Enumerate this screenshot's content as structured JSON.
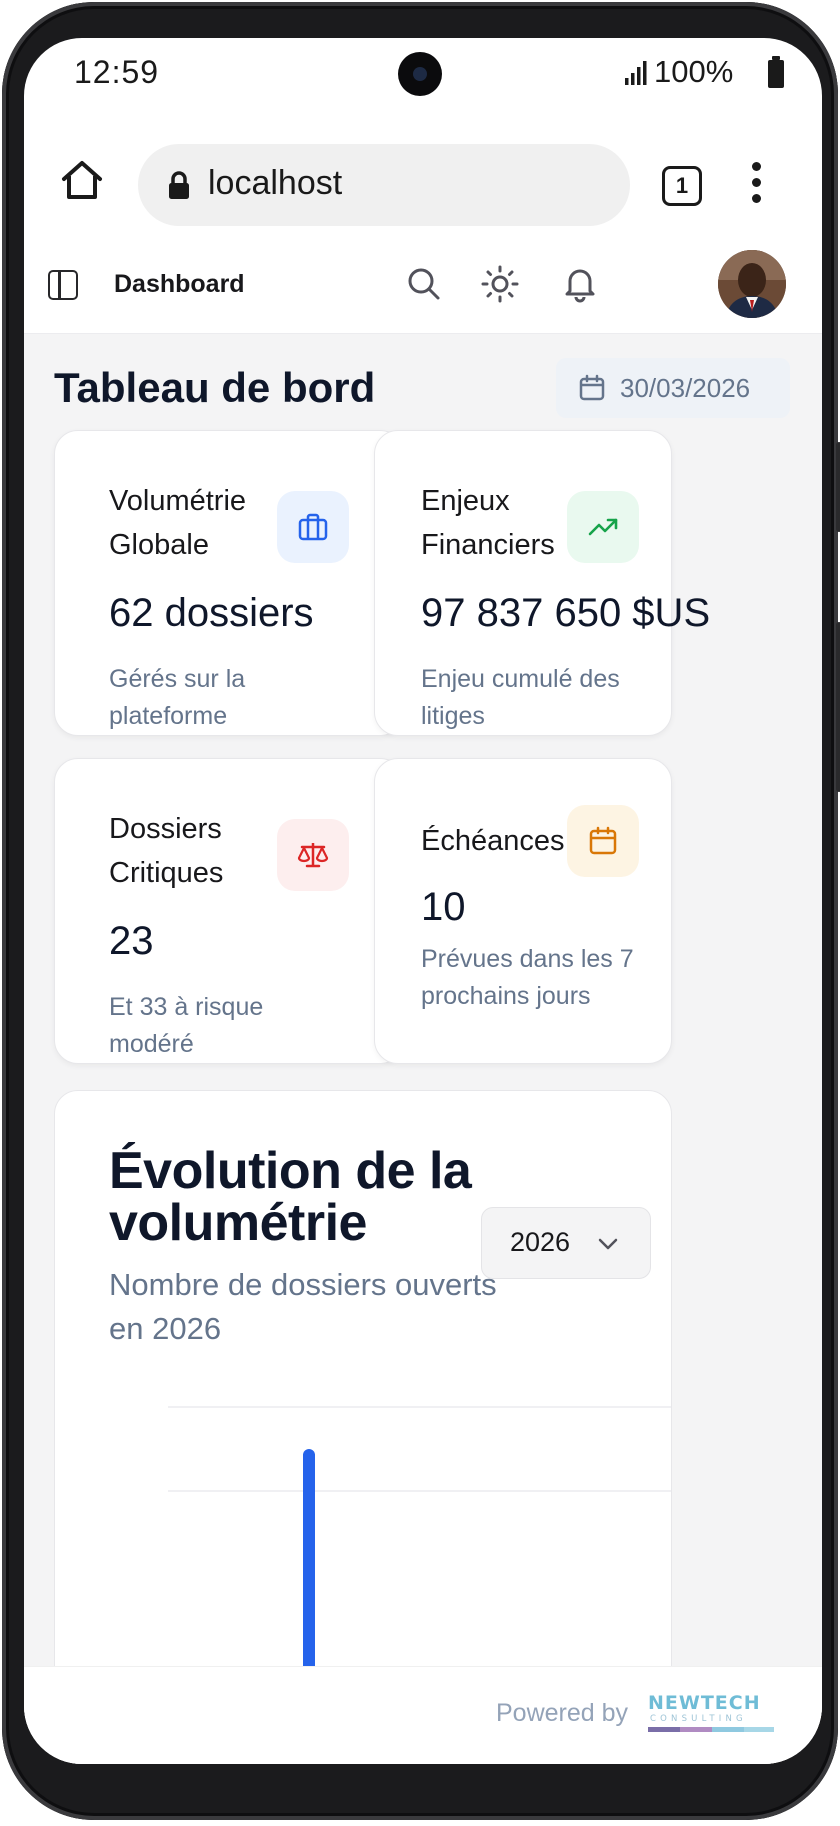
{
  "status_bar": {
    "time": "12:59",
    "battery": "100%"
  },
  "browser": {
    "url": "localhost",
    "tab_count": "1"
  },
  "nav": {
    "title": "Dashboard"
  },
  "page": {
    "title": "Tableau de bord",
    "date": "30/03/2026"
  },
  "cards": [
    {
      "label": "Volumétrie Globale",
      "value": "62 dossiers",
      "description": "Gérés sur la plateforme",
      "icon": "briefcase-icon",
      "accent": "#2563eb",
      "icon_bg": "#eaf2fe"
    },
    {
      "label": "Enjeux Financiers",
      "value": "97 837 650 $US",
      "description": "Enjeu cumulé des litiges",
      "icon": "trending-up-icon",
      "accent": "#16a34a",
      "icon_bg": "#e9f9ef"
    },
    {
      "label": "Dossiers Critiques",
      "value": "23",
      "description": "Et 33 à risque modéré",
      "icon": "scale-icon",
      "accent": "#dc2626",
      "icon_bg": "#fdeeee"
    },
    {
      "label": "Échéances",
      "value": "10",
      "description": "Prévues dans les 7 prochains jours",
      "icon": "calendar-icon",
      "accent": "#d97706",
      "icon_bg": "#fdf4e3"
    }
  ],
  "chart_section": {
    "title": "Évolution de la volumétrie",
    "subtitle": "Nombre de dossiers ouverts en 2026",
    "year_selected": "2026"
  },
  "chart_data": {
    "type": "bar",
    "title": "Évolution de la volumétrie",
    "subtitle": "Nombre de dossiers ouverts en 2026",
    "series": [
      {
        "values": [
          null,
          1
        ]
      }
    ],
    "grid": true,
    "bar_color": "#2563eb"
  },
  "footer": {
    "powered_by": "Powered by",
    "brand": "NEWTECH",
    "brand_sub": "CONSULTING"
  }
}
